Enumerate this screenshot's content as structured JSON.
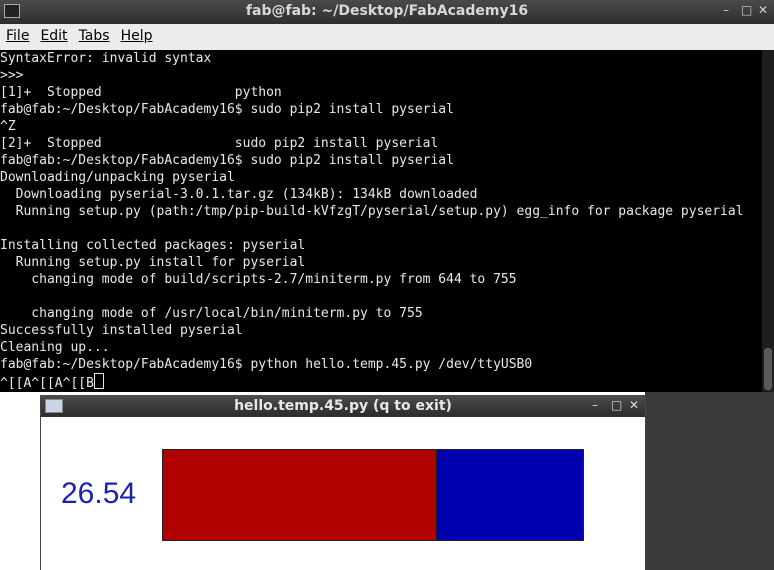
{
  "terminal": {
    "title": "fab@fab: ~/Desktop/FabAcademy16",
    "menu": [
      "File",
      "Edit",
      "Tabs",
      "Help"
    ],
    "lines": [
      "SyntaxError: invalid syntax",
      ">>>",
      "[1]+  Stopped                 python",
      "fab@fab:~/Desktop/FabAcademy16$ sudo pip2 install pyserial",
      "^Z",
      "[2]+  Stopped                 sudo pip2 install pyserial",
      "fab@fab:~/Desktop/FabAcademy16$ sudo pip2 install pyserial",
      "Downloading/unpacking pyserial",
      "  Downloading pyserial-3.0.1.tar.gz (134kB): 134kB downloaded",
      "  Running setup.py (path:/tmp/pip-build-kVfzgT/pyserial/setup.py) egg_info for package pyserial",
      "",
      "Installing collected packages: pyserial",
      "  Running setup.py install for pyserial",
      "    changing mode of build/scripts-2.7/miniterm.py from 644 to 755",
      "",
      "    changing mode of /usr/local/bin/miniterm.py to 755",
      "Successfully installed pyserial",
      "Cleaning up...",
      "fab@fab:~/Desktop/FabAcademy16$ python hello.temp.45.py /dev/ttyUSB0"
    ],
    "input_line": "^[[A^[[A^[[B"
  },
  "hello_window": {
    "title": "hello.temp.45.py (q to exit)",
    "value": "26.54",
    "bar_fraction": 0.65,
    "colors": {
      "fill": "#b00000",
      "remainder": "#0000b0",
      "value_text": "#1a22b0"
    }
  },
  "window_controls": [
    "minimize-icon",
    "maximize-icon",
    "close-icon"
  ]
}
